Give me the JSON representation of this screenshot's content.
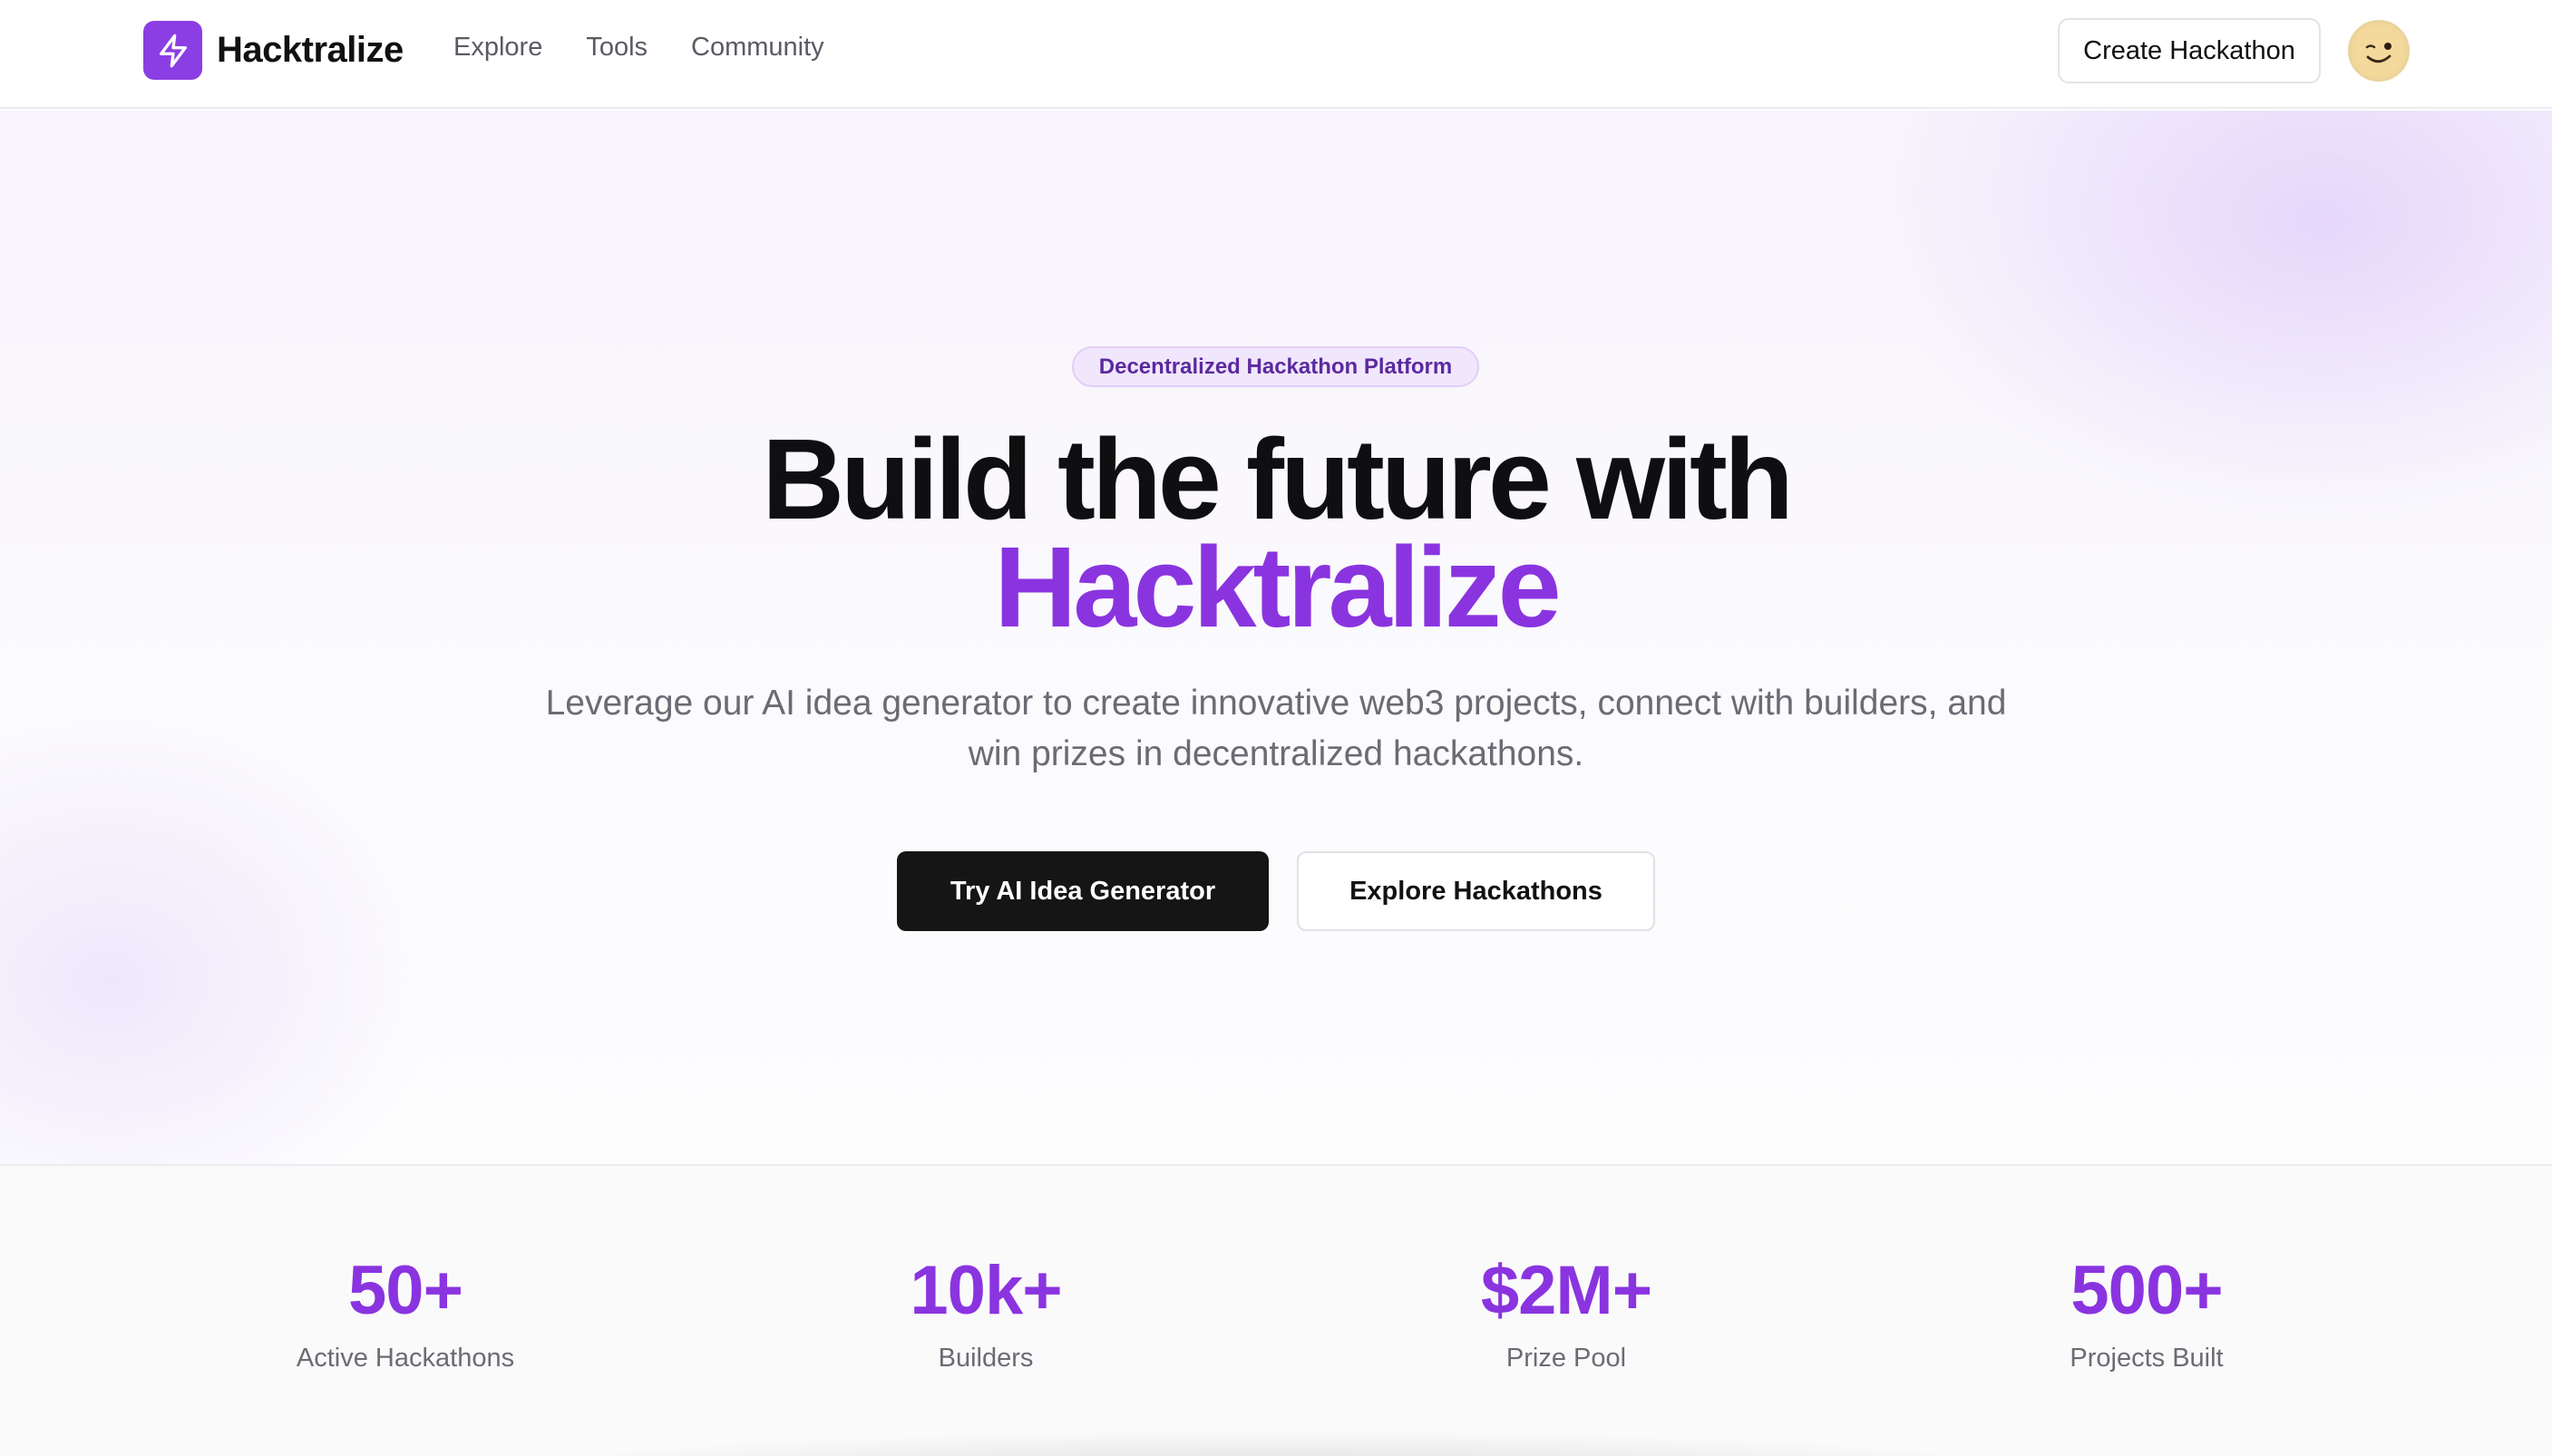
{
  "header": {
    "brand_name": "Hacktralize",
    "logo_icon": "lightning-bolt-icon",
    "nav": [
      {
        "label": "Explore"
      },
      {
        "label": "Tools"
      },
      {
        "label": "Community"
      }
    ],
    "create_button": "Create Hackathon",
    "avatar_icon": "winking-face-avatar"
  },
  "hero": {
    "badge": "Decentralized Hackathon Platform",
    "headline_line1": "Build the future with",
    "headline_line2": "Hacktralize",
    "subtext": "Leverage our AI idea generator to create innovative web3 projects, connect with builders, and win prizes in decentralized hackathons.",
    "primary_button": "Try AI Idea Generator",
    "secondary_button": "Explore Hackathons"
  },
  "stats": [
    {
      "value": "50+",
      "label": "Active Hackathons"
    },
    {
      "value": "10k+",
      "label": "Builders"
    },
    {
      "value": "$2M+",
      "label": "Prize Pool"
    },
    {
      "value": "500+",
      "label": "Projects Built"
    }
  ],
  "colors": {
    "accent": "#8a34e0",
    "logo_bg": "#8a3ee3",
    "primary_button_bg": "#151515",
    "badge_bg": "#f1e7fc",
    "badge_text": "#5b2aa0"
  }
}
